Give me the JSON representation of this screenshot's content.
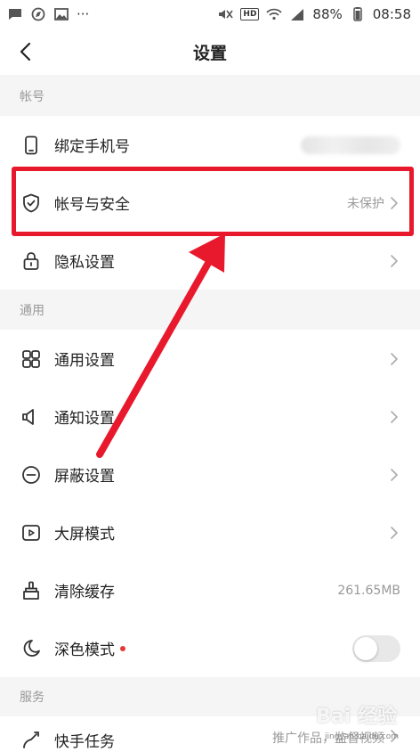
{
  "status_bar": {
    "battery": "88%",
    "time": "08:58",
    "hd": "HD",
    "more": "···"
  },
  "header": {
    "title": "设置"
  },
  "sections": {
    "account": "帐号",
    "general": "通用",
    "service": "服务"
  },
  "rows": {
    "bind_phone": {
      "label": "绑定手机号"
    },
    "account_security": {
      "label": "帐号与安全",
      "value": "未保护"
    },
    "privacy": {
      "label": "隐私设置"
    },
    "general_settings": {
      "label": "通用设置"
    },
    "notification": {
      "label": "通知设置"
    },
    "block": {
      "label": "屏蔽设置"
    },
    "big_screen": {
      "label": "大屏模式"
    },
    "clear_cache": {
      "label": "清除缓存",
      "value": "261.65MB"
    },
    "dark_mode": {
      "label": "深色模式"
    },
    "kuaishou_task": {
      "label": "快手任务",
      "value": "推广作品，监督视频"
    }
  },
  "watermark": {
    "brand": "Bai 经验",
    "url": "jingyan.baidu.com"
  },
  "colors": {
    "highlight": "#e8192c",
    "accent_dot": "#e53935"
  }
}
